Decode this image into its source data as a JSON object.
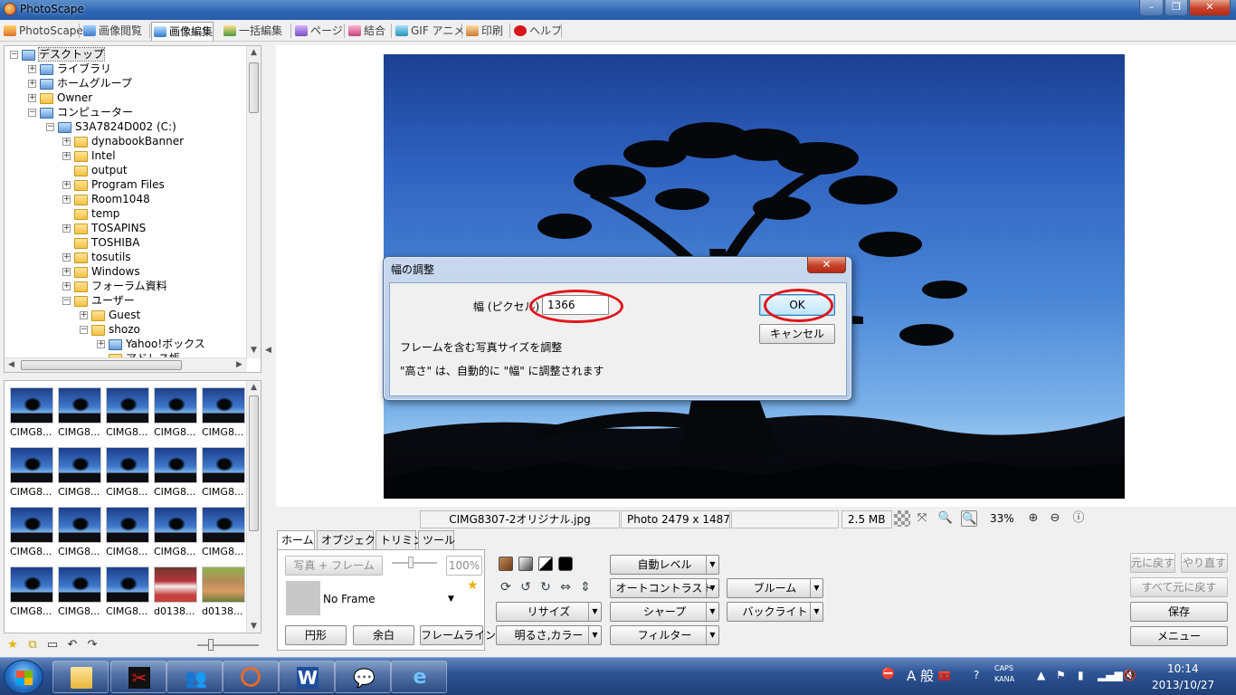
{
  "window": {
    "title": "PhotoScape"
  },
  "tabs": [
    {
      "label": "PhotoScape"
    },
    {
      "label": "画像閲覧"
    },
    {
      "label": "画像編集"
    },
    {
      "label": "一括編集"
    },
    {
      "label": "ページ"
    },
    {
      "label": "結合"
    },
    {
      "label": "GIF アニメ"
    },
    {
      "label": "印刷"
    },
    {
      "label": "ヘルプ"
    }
  ],
  "tree": {
    "items": [
      {
        "label": "デスクトップ"
      },
      {
        "label": "ライブラリ"
      },
      {
        "label": "ホームグループ"
      },
      {
        "label": "Owner"
      },
      {
        "label": "コンピューター"
      },
      {
        "label": "S3A7824D002 (C:)"
      },
      {
        "label": "dynabookBanner"
      },
      {
        "label": "Intel"
      },
      {
        "label": "output"
      },
      {
        "label": "Program Files"
      },
      {
        "label": "Room1048"
      },
      {
        "label": "temp"
      },
      {
        "label": "TOSAPINS"
      },
      {
        "label": "TOSHIBA"
      },
      {
        "label": "tosutils"
      },
      {
        "label": "Windows"
      },
      {
        "label": "フォーラム資料"
      },
      {
        "label": "ユーザー"
      },
      {
        "label": "Guest"
      },
      {
        "label": "shozo"
      },
      {
        "label": "Yahoo!ボックス"
      },
      {
        "label": "アドレス帳"
      }
    ]
  },
  "thumbnails": [
    {
      "caption": "CIMG8..."
    },
    {
      "caption": "CIMG8..."
    },
    {
      "caption": "CIMG8..."
    },
    {
      "caption": "CIMG8..."
    },
    {
      "caption": "CIMG8..."
    },
    {
      "caption": "CIMG8..."
    },
    {
      "caption": "CIMG8..."
    },
    {
      "caption": "CIMG8..."
    },
    {
      "caption": "CIMG8..."
    },
    {
      "caption": "CIMG8..."
    },
    {
      "caption": "CIMG8..."
    },
    {
      "caption": "CIMG8..."
    },
    {
      "caption": "CIMG8..."
    },
    {
      "caption": "CIMG8..."
    },
    {
      "caption": "CIMG8..."
    },
    {
      "caption": "CIMG8..."
    },
    {
      "caption": "CIMG8..."
    },
    {
      "caption": "CIMG8..."
    },
    {
      "caption": "d0138..."
    },
    {
      "caption": "d0138..."
    }
  ],
  "status": {
    "filename": "CIMG8307-2オリジナル.jpg",
    "dimensions": "Photo 2479 x 1487",
    "filesize": "2.5 MB",
    "zoom": "33%"
  },
  "edit_tabs": [
    {
      "label": "ホーム"
    },
    {
      "label": "オブジェクト"
    },
    {
      "label": "トリミング"
    },
    {
      "label": "ツール"
    }
  ],
  "edit_panel": {
    "photo_frame_button": "写真 + フレーム",
    "frame_scale": "100%",
    "frame_select": "No Frame",
    "circle_button": "円形",
    "margin_button": "余白",
    "frameline_button": "フレームライン",
    "resize_button": "リサイズ",
    "brightness_button": "明るさ,カラー",
    "auto_level_button": "自動レベル",
    "auto_contrast_button": "オートコントラスト",
    "sharpen_button": "シャープ",
    "filter_button": "フィルター",
    "bloom_button": "ブルーム",
    "backlight_button": "バックライト",
    "undo_button": "元に戻す",
    "redo_button": "やり直す",
    "undo_all_button": "すべて元に戻す",
    "save_button": "保存",
    "menu_button": "メニュー"
  },
  "dialog": {
    "title": "幅の調整",
    "width_label": "幅 (ピクセル)",
    "width_value": "1366",
    "ok_label": "OK",
    "cancel_label": "キャンセル",
    "note1": "フレームを含む写真サイズを調整",
    "note2": "\"高さ\" は、自動的に \"幅\" に調整されます"
  },
  "taskbar": {
    "ime": "A 般",
    "caps": "CAPS",
    "kana": "KANA",
    "time": "10:14",
    "date": "2013/10/27"
  },
  "colors": {
    "annotation_red": "#e0141c",
    "titlebar_blue": "#2b64b4"
  }
}
